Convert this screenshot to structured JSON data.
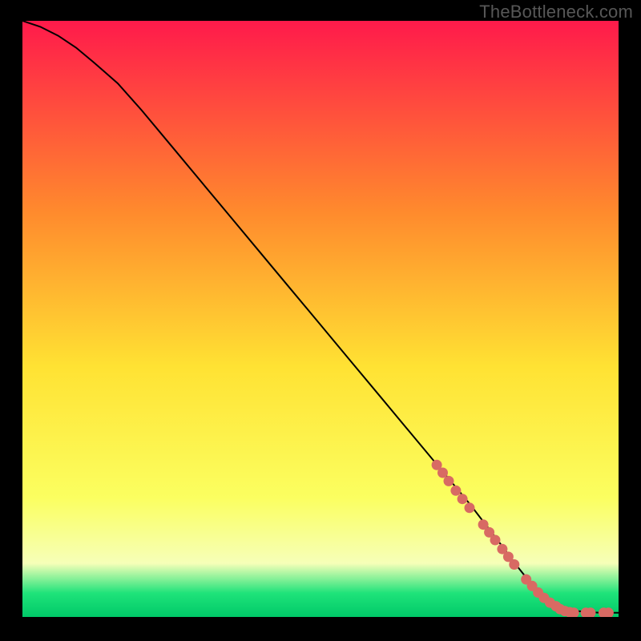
{
  "watermark": "TheBottleneck.com",
  "colors": {
    "black": "#000000",
    "curve": "#000000",
    "dot_fill": "#d86a63",
    "dot_stroke": "#b24a44",
    "grad_top": "#ff1a4b",
    "grad_mid_upper": "#ff8a2d",
    "grad_mid": "#ffe233",
    "grad_lower": "#fbff60",
    "grad_pale": "#f6ffb8",
    "grad_green": "#1fe37a",
    "grad_green_deep": "#00c968"
  },
  "chart_data": {
    "type": "line",
    "title": "",
    "xlabel": "",
    "ylabel": "",
    "xlim": [
      0,
      100
    ],
    "ylim": [
      0,
      100
    ],
    "series": [
      {
        "name": "curve",
        "x": [
          0,
          3,
          6,
          9,
          12,
          16,
          20,
          25,
          30,
          35,
          40,
          45,
          50,
          55,
          60,
          65,
          70,
          75,
          80,
          83,
          85,
          87,
          89,
          91,
          93,
          95,
          97,
          99,
          100
        ],
        "y": [
          100,
          99,
          97.5,
          95.5,
          93,
          89.5,
          85,
          79,
          73,
          67,
          61,
          55,
          49,
          43,
          37,
          31,
          25,
          19,
          12.5,
          8.5,
          6,
          4,
          2.5,
          1.5,
          1,
          0.8,
          0.7,
          0.7,
          0.7
        ]
      }
    ],
    "dots": [
      {
        "x": 69.5,
        "y": 25.5
      },
      {
        "x": 70.5,
        "y": 24.2
      },
      {
        "x": 71.5,
        "y": 22.8
      },
      {
        "x": 72.7,
        "y": 21.2
      },
      {
        "x": 73.8,
        "y": 19.8
      },
      {
        "x": 75.0,
        "y": 18.3
      },
      {
        "x": 77.3,
        "y": 15.5
      },
      {
        "x": 78.3,
        "y": 14.2
      },
      {
        "x": 79.3,
        "y": 12.9
      },
      {
        "x": 80.5,
        "y": 11.4
      },
      {
        "x": 81.5,
        "y": 10.1
      },
      {
        "x": 82.5,
        "y": 8.8
      },
      {
        "x": 84.5,
        "y": 6.3
      },
      {
        "x": 85.5,
        "y": 5.2
      },
      {
        "x": 86.5,
        "y": 4.1
      },
      {
        "x": 87.5,
        "y": 3.2
      },
      {
        "x": 88.5,
        "y": 2.4
      },
      {
        "x": 89.5,
        "y": 1.8
      },
      {
        "x": 90.2,
        "y": 1.3
      },
      {
        "x": 91.0,
        "y": 1.0
      },
      {
        "x": 91.8,
        "y": 0.8
      },
      {
        "x": 92.5,
        "y": 0.7
      },
      {
        "x": 94.5,
        "y": 0.7
      },
      {
        "x": 95.3,
        "y": 0.7
      },
      {
        "x": 97.5,
        "y": 0.7
      },
      {
        "x": 98.3,
        "y": 0.7
      }
    ]
  }
}
